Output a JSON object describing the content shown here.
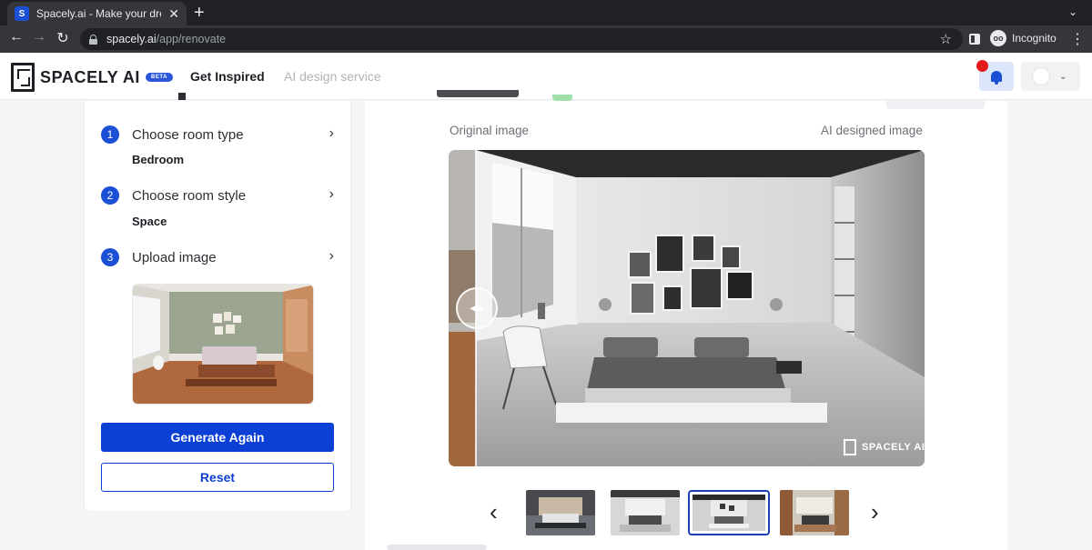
{
  "browser": {
    "tab_title": "Spacely.ai - Make your dream",
    "tab_favicon": "spacely-favicon",
    "new_tab_symbol": "+",
    "url_host": "spacely.ai",
    "url_path": "/app/renovate",
    "profile_label": "Incognito"
  },
  "header": {
    "logo_text": "SPACELY AI",
    "beta_badge": "BETA",
    "nav": [
      {
        "label": "Get Inspired",
        "active": true
      },
      {
        "label": "AI design service",
        "active": false
      }
    ],
    "notification_dot_color": "#e51a1a"
  },
  "steps": [
    {
      "number": "1",
      "label": "Choose room type",
      "value": "Bedroom"
    },
    {
      "number": "2",
      "label": "Choose room style",
      "value": "Space"
    },
    {
      "number": "3",
      "label": "Upload image",
      "value": ""
    }
  ],
  "actions": {
    "generate_label": "Generate Again",
    "reset_label": "Reset"
  },
  "compare": {
    "original_label": "Original image",
    "ai_label": "AI designed image",
    "watermark": "SPACELY AI",
    "slider_glyph": "◀▶"
  },
  "carousel": {
    "prev_glyph": "‹",
    "next_glyph": "›",
    "thumbnail_count": 4,
    "selected_index": 2
  },
  "colors": {
    "primary": "#0c3fd4",
    "step_badge": "#1a4fd6"
  }
}
